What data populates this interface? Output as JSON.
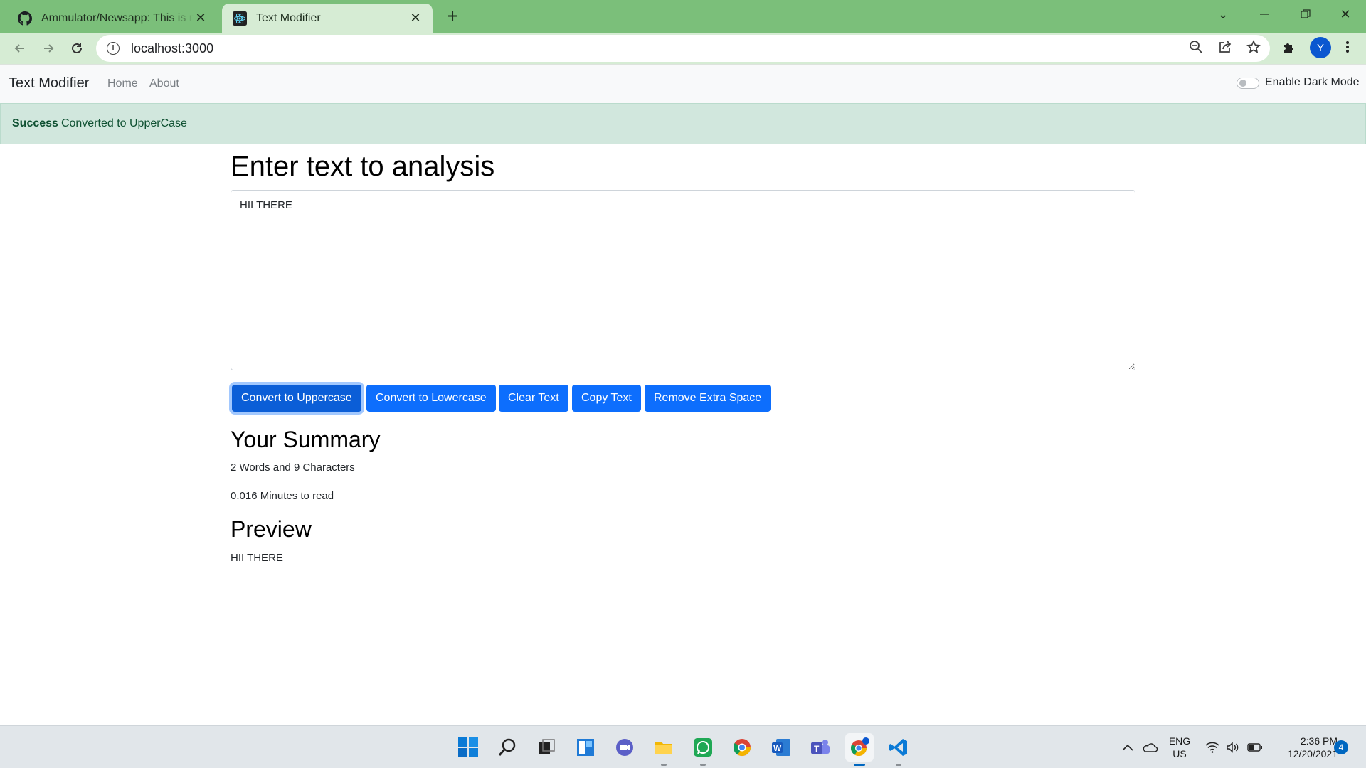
{
  "browser": {
    "tabs": [
      {
        "title": "Ammulator/Newsapp: This is new",
        "icon": "github-icon"
      },
      {
        "title": "Text Modifier",
        "icon": "react-icon"
      }
    ],
    "address": "localhost:3000"
  },
  "navbar": {
    "brand": "Text Modifier",
    "links": [
      "Home",
      "About"
    ],
    "dark_mode_label": "Enable Dark Mode",
    "dark_mode_enabled": false
  },
  "alert": {
    "type": "Success",
    "message": "Converted to UpperCase"
  },
  "main": {
    "heading": "Enter text to analysis",
    "textarea_value": "HII THERE",
    "buttons": [
      "Convert to Uppercase",
      "Convert to Lowercase",
      "Clear Text",
      "Copy Text",
      "Remove Extra Space"
    ],
    "summary_heading": "Your Summary",
    "summary_counts": "2 Words and 9 Characters",
    "summary_read_time": "0.016 Minutes to read",
    "preview_heading": "Preview",
    "preview_text": "HII THERE"
  },
  "taskbar": {
    "apps": [
      "start",
      "search",
      "task-view",
      "widgets",
      "chat",
      "file-explorer",
      "whatsapp",
      "chrome",
      "word",
      "teams",
      "chrome-profile",
      "vscode"
    ],
    "language": [
      "ENG",
      "US"
    ],
    "time": "2:36 PM",
    "date": "12/20/2021",
    "notifications": "4"
  },
  "colors": {
    "chrome_frame": "#7bbf7a",
    "primary": "#0d6efd",
    "alert_bg": "#d1e7dd",
    "alert_text": "#0f5132"
  }
}
